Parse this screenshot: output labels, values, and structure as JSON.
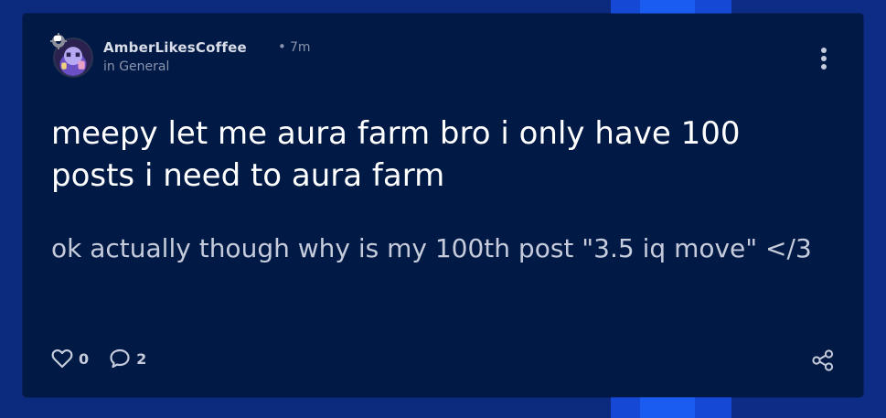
{
  "post": {
    "author": "AmberLikesCoffee",
    "separator": "•",
    "time": "7m",
    "group": "in General",
    "title": "meepy let me aura farm bro i only have 100 posts i need to aura farm",
    "body": "ok actually though why is my 100th post \"3.5 iq move\" </3",
    "likes": "0",
    "comments": "2"
  },
  "icons": {
    "badge": "speech-gear-icon",
    "more": "more-vertical-icon",
    "like": "heart-icon",
    "comment": "comment-icon",
    "share": "share-icon"
  },
  "colors": {
    "card_background": "#011945",
    "page_background": "#0b2a7e",
    "text_primary": "#ffffff",
    "text_secondary": "#c5cbdb",
    "text_muted": "#8a93ad"
  }
}
